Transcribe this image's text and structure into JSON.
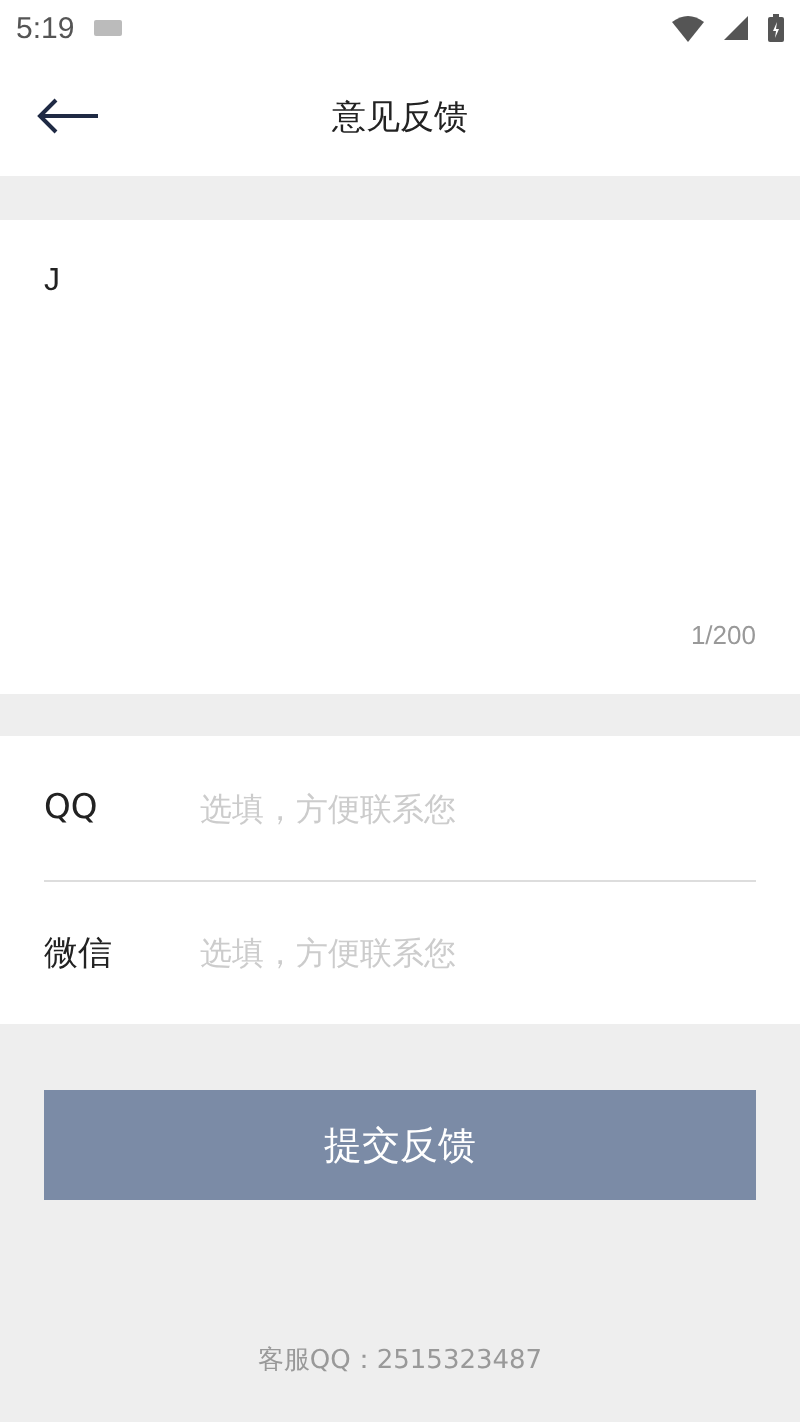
{
  "status_bar": {
    "time": "5:19"
  },
  "header": {
    "title": "意见反馈"
  },
  "feedback": {
    "value": "J",
    "counter": "1/200"
  },
  "contacts": [
    {
      "label": "QQ",
      "placeholder": "选填，方便联系您"
    },
    {
      "label": "微信",
      "placeholder": "选填，方便联系您"
    }
  ],
  "submit": "提交反馈",
  "footer": "客服QQ：2515323487"
}
